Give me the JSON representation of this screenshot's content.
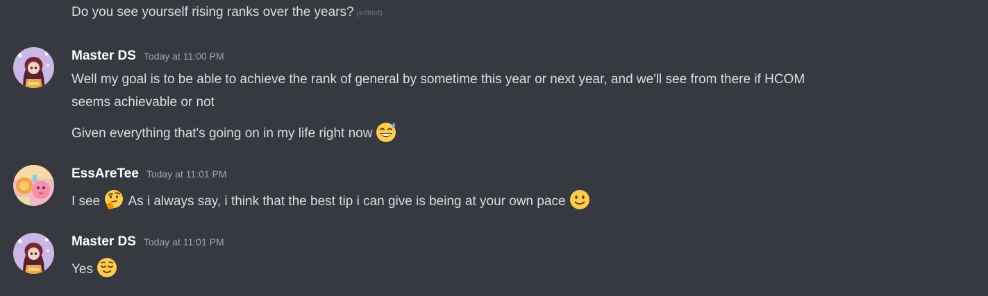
{
  "messages": [
    {
      "continuation_text": "Do you see yourself rising ranks over the years?",
      "edited_label": "(edited)"
    },
    {
      "author": "Master DS",
      "timestamp": "Today at 11:00 PM",
      "lines": [
        "Well my goal is to be able to achieve the rank of general by sometime this year or next year, and we'll see from there if HCOM",
        "seems achievable or not",
        "Given everything that's going on in my life right now"
      ],
      "emojis": [
        "grinning-sweat-emoji"
      ]
    },
    {
      "author": "EssAreTee",
      "timestamp": "Today at 11:01 PM",
      "text_part1": "I see",
      "text_part2": "As i always say, i think that the best tip i can give is being at your own pace",
      "emojis": [
        "thinking-emoji",
        "slight-smile-emoji"
      ]
    },
    {
      "author": "Master DS",
      "timestamp": "Today at 11:01 PM",
      "text": "Yes",
      "emojis": [
        "relieved-emoji"
      ]
    }
  ],
  "colors": {
    "background": "#36393f",
    "message_text": "#dcddde",
    "username": "#ffffff",
    "timestamp": "#a3a6aa",
    "emoji_yellow": "#ffcc4d"
  }
}
